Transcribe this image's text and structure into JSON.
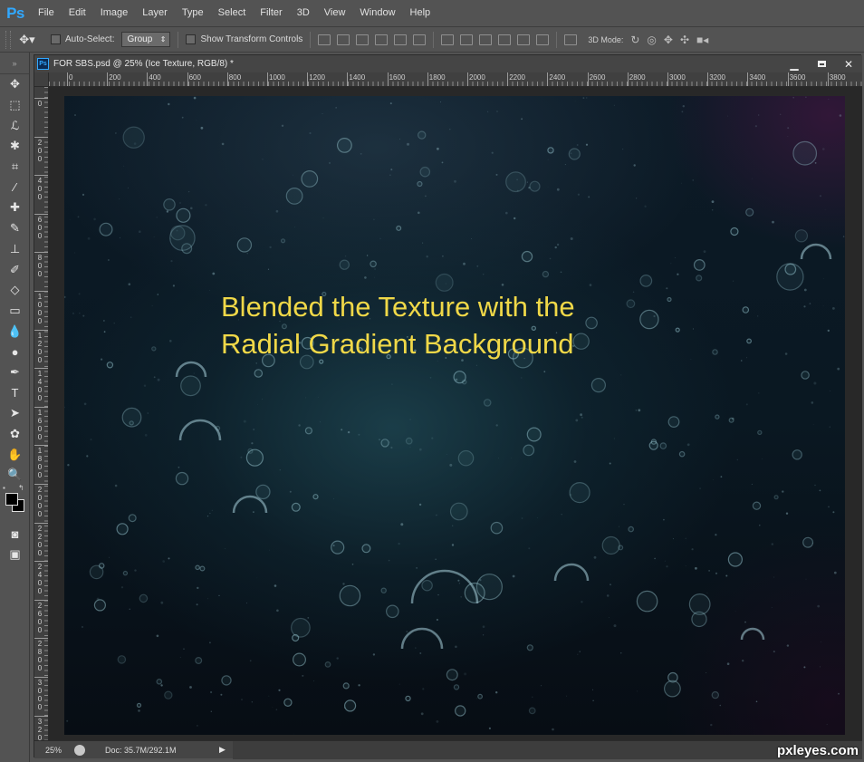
{
  "app": {
    "logo": "Ps"
  },
  "menu": [
    "File",
    "Edit",
    "Image",
    "Layer",
    "Type",
    "Select",
    "Filter",
    "3D",
    "View",
    "Window",
    "Help"
  ],
  "options": {
    "auto_select_label": "Auto-Select:",
    "auto_select_value": "Group",
    "transform_label": "Show Transform Controls",
    "mode_3d_label": "3D Mode:"
  },
  "document": {
    "title": "FOR SBS.psd @ 25% (Ice Texture, RGB/8) *",
    "ruler_h": [
      "0",
      "200",
      "400",
      "600",
      "800",
      "1000",
      "1200",
      "1400",
      "1600",
      "1800",
      "2000",
      "2200",
      "2400",
      "2600",
      "2800",
      "3000",
      "3200",
      "3400",
      "3600",
      "3800"
    ],
    "ruler_v": [
      "0",
      "2 0 0",
      "4 0 0",
      "6 0 0",
      "8 0 0",
      "1 0 0 0",
      "1 2 0 0",
      "1 4 0 0",
      "1 6 0 0",
      "1 8 0 0",
      "2 0 0 0",
      "2 2 0 0",
      "2 4 0 0",
      "2 6 0 0",
      "2 8 0 0",
      "3 0 0 0",
      "3 2 0"
    ],
    "annotation_line1": "Blended the Texture with the",
    "annotation_line2": "Radial Gradient Background",
    "annotation_color": "#f0d848"
  },
  "status": {
    "zoom": "25%",
    "doc_info": "Doc: 35.7M/292.1M",
    "arrow": "▶"
  },
  "watermark": "pxleyes.com",
  "tools": [
    "move-tool",
    "marquee-tool",
    "lasso-tool",
    "quick-selection-tool",
    "crop-tool",
    "eyedropper-tool",
    "healing-brush-tool",
    "brush-tool",
    "clone-stamp-tool",
    "history-brush-tool",
    "eraser-tool",
    "gradient-tool",
    "blur-tool",
    "dodge-tool",
    "pen-tool",
    "type-tool",
    "path-selection-tool",
    "shape-tool",
    "hand-tool",
    "zoom-tool"
  ]
}
